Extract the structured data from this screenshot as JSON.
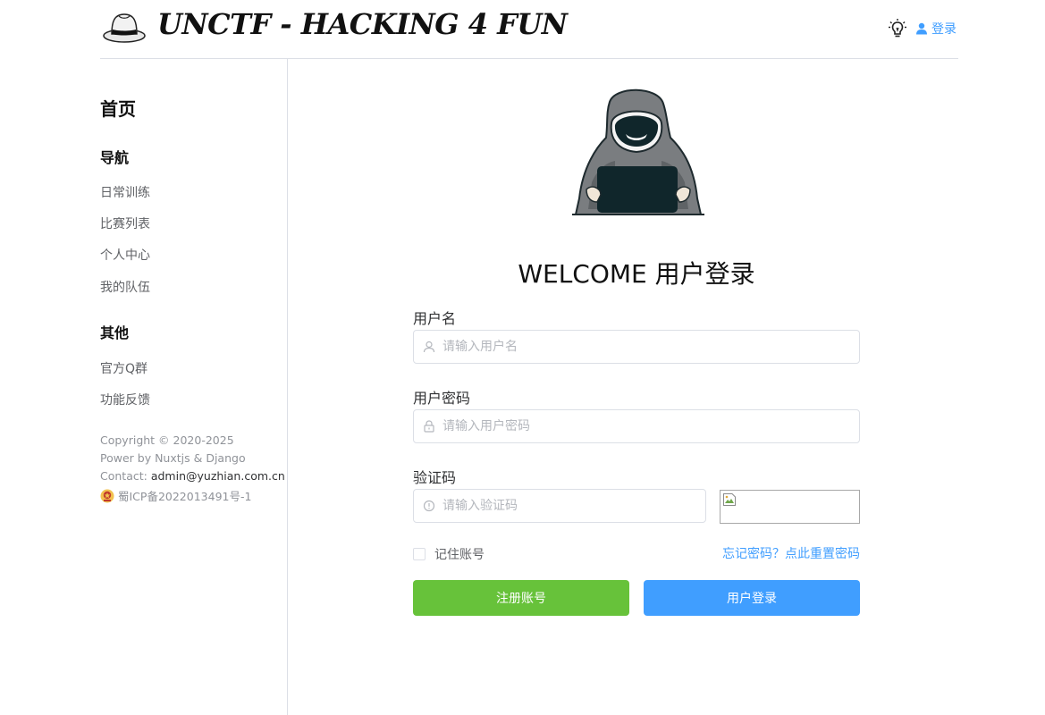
{
  "header": {
    "site_title": "UNCTF - HACKING 4 FUN",
    "login_label": "登录"
  },
  "sidebar": {
    "home": "首页",
    "section_nav": "导航",
    "nav_items": [
      "日常训练",
      "比赛列表",
      "个人中心",
      "我的队伍"
    ],
    "section_other": "其他",
    "other_items": [
      "官方Q群",
      "功能反馈"
    ],
    "footer": {
      "copyright": "Copyright © 2020-2025",
      "power": "Power by Nuxtjs & Django",
      "contact_prefix": "Contact: ",
      "contact_email": "admin@yuzhian.com.cn",
      "icp": "蜀ICP备2022013491号-1"
    }
  },
  "main": {
    "welcome": "WELCOME 用户登录",
    "username": {
      "label": "用户名",
      "placeholder": "请输入用户名",
      "value": ""
    },
    "password": {
      "label": "用户密码",
      "placeholder": "请输入用户密码",
      "value": ""
    },
    "captcha": {
      "label": "验证码",
      "placeholder": "请输入验证码",
      "value": ""
    },
    "remember_label": "记住账号",
    "remember_checked": false,
    "forgot_link": "忘记密码？点此重置密码",
    "register_button": "注册账号",
    "login_button": "用户登录"
  },
  "colors": {
    "primary": "#409eff",
    "success": "#67c23a",
    "border": "#dcdfe6",
    "text_secondary": "#606266"
  },
  "icons": [
    "fedora-hat-logo",
    "lightbulb-icon",
    "user-icon",
    "hacker-illustration",
    "police-badge-icon",
    "lock-icon",
    "info-circle-icon",
    "broken-image-icon"
  ]
}
